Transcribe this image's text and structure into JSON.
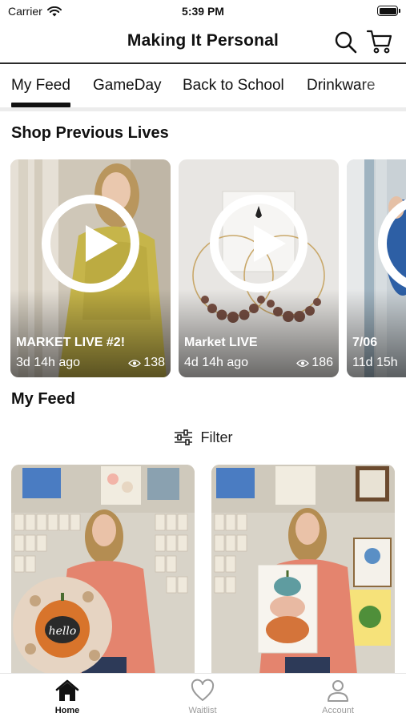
{
  "status_bar": {
    "carrier": "Carrier",
    "time": "5:39 PM"
  },
  "header": {
    "title": "Making It Personal"
  },
  "tabs": [
    {
      "label": "My Feed",
      "active": true
    },
    {
      "label": "GameDay",
      "active": false
    },
    {
      "label": "Back to School",
      "active": false
    },
    {
      "label": "Drinkware",
      "active": false
    }
  ],
  "sections": {
    "lives_title": "Shop Previous Lives",
    "feed_title": "My Feed"
  },
  "lives": [
    {
      "title": "MARKET LIVE #2!",
      "time": "3d 14h ago",
      "views": "138"
    },
    {
      "title": "Market LIVE",
      "time": "4d 14h ago",
      "views": "186"
    },
    {
      "title": "7/06",
      "time": "11d 15h",
      "views": ""
    }
  ],
  "filter": {
    "label": "Filter"
  },
  "feed_items": [
    {
      "image": "woman-holding-hello-pumpkin-sign",
      "sign_text": "hello"
    },
    {
      "image": "woman-holding-stacked-pumpkins-canvas"
    }
  ],
  "bottom_nav": [
    {
      "label": "Home",
      "icon": "home-icon",
      "active": true
    },
    {
      "label": "Waitlist",
      "icon": "heart-icon",
      "active": false
    },
    {
      "label": "Account",
      "icon": "person-icon",
      "active": false
    }
  ],
  "colors": {
    "text": "#111111",
    "muted": "#9a9a9a",
    "divider": "#ececec"
  }
}
